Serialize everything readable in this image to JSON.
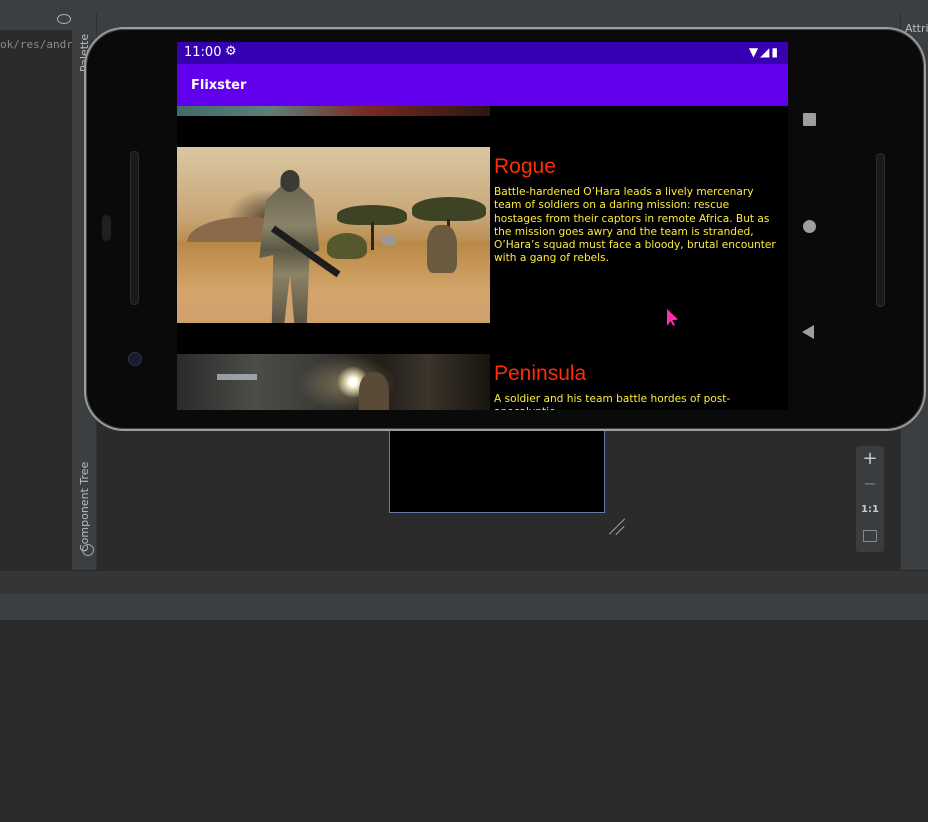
{
  "ide": {
    "editor_path": "ok/res/andr",
    "palette_label": "Palette",
    "component_tree_label": "Component Tree",
    "attributes_label": "Attrib",
    "zoom": {
      "plus": "+",
      "minus": "−",
      "actual_size": "1:1"
    }
  },
  "device": {
    "status_bar": {
      "time": "11:00"
    },
    "app_bar": {
      "title": "Flixster"
    },
    "movies": [
      {
        "title": "Rogue",
        "overview": "Battle-hardened O’Hara leads a lively mercenary team of soldiers on a daring mission: rescue hostages from their captors in remote Africa. But as the mission goes awry and the team is stranded, O’Hara’s squad must face a bloody, brutal encounter with a gang of rebels."
      },
      {
        "title": "Peninsula",
        "overview": "A soldier and his team battle hordes of post-apocalyptic"
      }
    ]
  },
  "colors": {
    "status_bar": "#3700b3",
    "app_bar": "#6200ee",
    "movie_title": "#ff2d07",
    "movie_overview": "#ffeb3b",
    "cursor": "#ff2fa8"
  },
  "icons": [
    "eye-icon",
    "gear-icon",
    "wifi-icon",
    "signal-icon",
    "battery-icon",
    "square-nav-icon",
    "home-nav-icon",
    "back-nav-icon",
    "globe-icon",
    "resize-handle-icon",
    "mouse-cursor-icon"
  ]
}
